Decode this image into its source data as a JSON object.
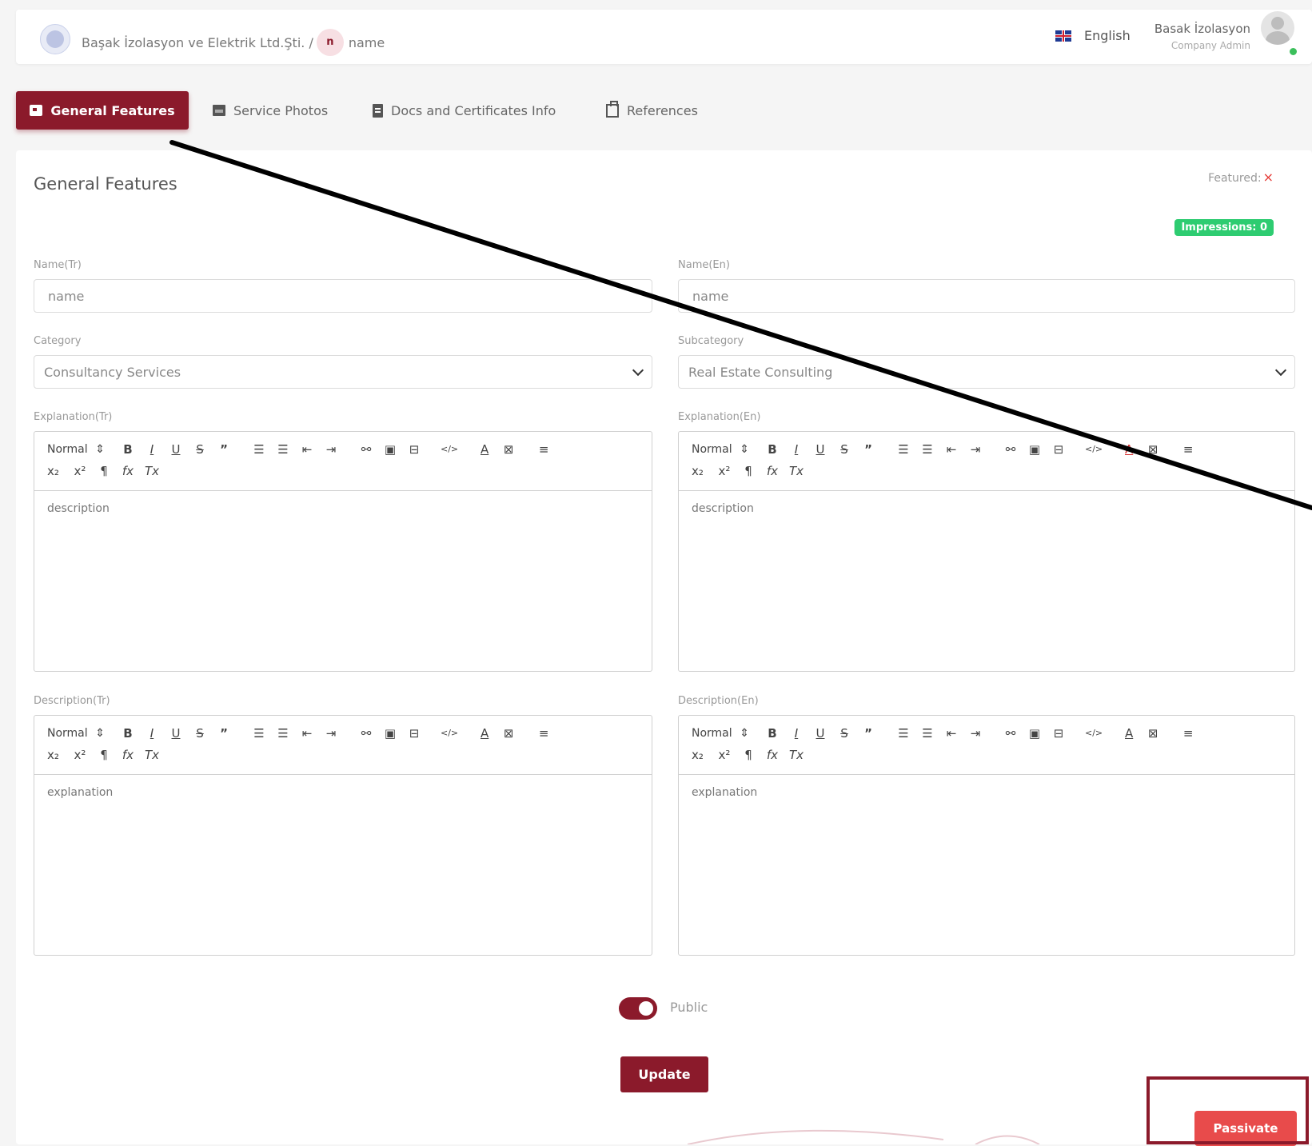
{
  "header": {
    "company": "Başak İzolasyon ve Elektrik Ltd.Şti. /",
    "avatar_letter": "n",
    "entity": "name",
    "language": "English",
    "user_name": "Basak İzolasyon",
    "user_role": "Company Admin"
  },
  "tabs": [
    {
      "label": "General Features",
      "icon": "id-card-icon",
      "active": true
    },
    {
      "label": "Service Photos",
      "icon": "photo-icon",
      "active": false
    },
    {
      "label": "Docs and Certificates Info",
      "icon": "document-icon",
      "active": false
    },
    {
      "label": "References",
      "icon": "clipboard-icon",
      "active": false
    }
  ],
  "card": {
    "title": "General Features",
    "featured_label": "Featured:",
    "featured_mark": "×",
    "impressions": "Impressions: 0"
  },
  "form": {
    "name_tr": {
      "label": "Name(Tr)",
      "value": "name"
    },
    "name_en": {
      "label": "Name(En)",
      "value": "name"
    },
    "category": {
      "label": "Category",
      "value": "Consultancy Services"
    },
    "subcategory": {
      "label": "Subcategory",
      "value": "Real Estate Consulting"
    },
    "explanation_tr": {
      "label": "Explanation(Tr)",
      "content": "description"
    },
    "explanation_en": {
      "label": "Explanation(En)",
      "content": "description"
    },
    "description_tr": {
      "label": "Description(Tr)",
      "content": "explanation"
    },
    "description_en": {
      "label": "Description(En)",
      "content": "explanation"
    }
  },
  "editor_toolbar": {
    "format": "Normal",
    "format_arrows": "⇕"
  },
  "public": {
    "label": "Public",
    "enabled": true
  },
  "buttons": {
    "update": "Update",
    "passivate": "Passivate"
  },
  "colors": {
    "brand": "#8b1a2b",
    "danger": "#e84b4b",
    "success": "#2ecc71"
  }
}
